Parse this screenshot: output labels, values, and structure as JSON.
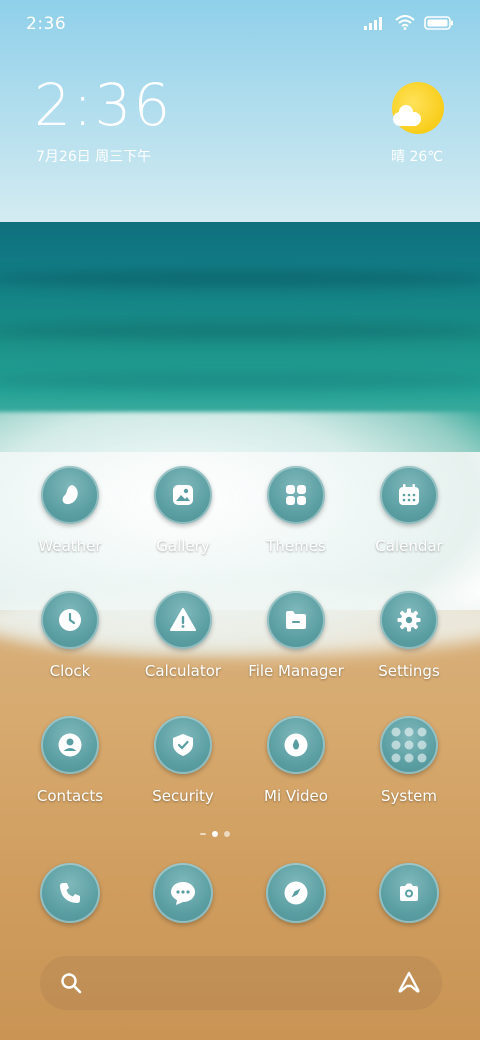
{
  "status_bar": {
    "time": "2:36"
  },
  "clock_widget": {
    "time": "2:36",
    "date": "7月26日 周三下午"
  },
  "weather_widget": {
    "text": "晴 26℃"
  },
  "apps": [
    {
      "label": "Weather",
      "icon": "weather-drop-icon"
    },
    {
      "label": "Gallery",
      "icon": "gallery-icon"
    },
    {
      "label": "Themes",
      "icon": "themes-grid-icon"
    },
    {
      "label": "Calendar",
      "icon": "calendar-icon"
    },
    {
      "label": "Clock",
      "icon": "clock-icon"
    },
    {
      "label": "Calculator",
      "icon": "warning-triangle-icon"
    },
    {
      "label": "File Manager",
      "icon": "folder-icon"
    },
    {
      "label": "Settings",
      "icon": "gear-icon"
    },
    {
      "label": "Contacts",
      "icon": "person-icon"
    },
    {
      "label": "Security",
      "icon": "shield-icon"
    },
    {
      "label": "Mi Video",
      "icon": "video-icon"
    },
    {
      "label": "System",
      "icon": "folder-grid-icon"
    }
  ],
  "dock": [
    {
      "name": "phone",
      "icon": "phone-icon"
    },
    {
      "name": "messages",
      "icon": "message-icon"
    },
    {
      "name": "browser",
      "icon": "compass-icon"
    },
    {
      "name": "camera",
      "icon": "camera-icon"
    }
  ],
  "page_indicator": {
    "pages": 2,
    "active": 1
  },
  "colors": {
    "icon_bg": "#5a9ea2",
    "sun": "#f5c400"
  }
}
